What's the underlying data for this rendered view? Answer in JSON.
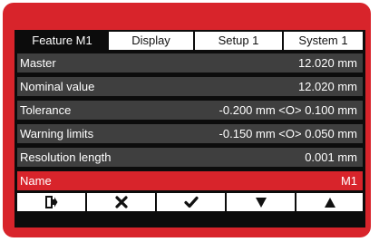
{
  "tabs": [
    {
      "label": "Feature  M1",
      "active": true
    },
    {
      "label": "Display",
      "active": false
    },
    {
      "label": "Setup 1",
      "active": false
    },
    {
      "label": "System 1",
      "active": false
    }
  ],
  "rows": [
    {
      "label": "Master",
      "value": "12.020 mm"
    },
    {
      "label": "Nominal value",
      "value": "12.020 mm"
    },
    {
      "label": "Tolerance",
      "value": "-0.200 mm <O> 0.100 mm"
    },
    {
      "label": "Warning limits",
      "value": "-0.150 mm <O> 0.050 mm"
    },
    {
      "label": "Resolution length",
      "value": "0.001 mm"
    },
    {
      "label": "Name",
      "value": "M1",
      "selected": true
    }
  ],
  "toolbar": {
    "buttons": [
      {
        "icon": "exit-icon"
      },
      {
        "icon": "cancel-x-icon"
      },
      {
        "icon": "confirm-check-icon"
      },
      {
        "icon": "arrow-down-icon"
      },
      {
        "icon": "arrow-up-icon"
      }
    ]
  },
  "colors": {
    "frame": "#d8242b",
    "screen": "#0c0c0c",
    "row": "#3f3f3f",
    "selected_row": "#d8242b",
    "text": "#ffffff"
  }
}
